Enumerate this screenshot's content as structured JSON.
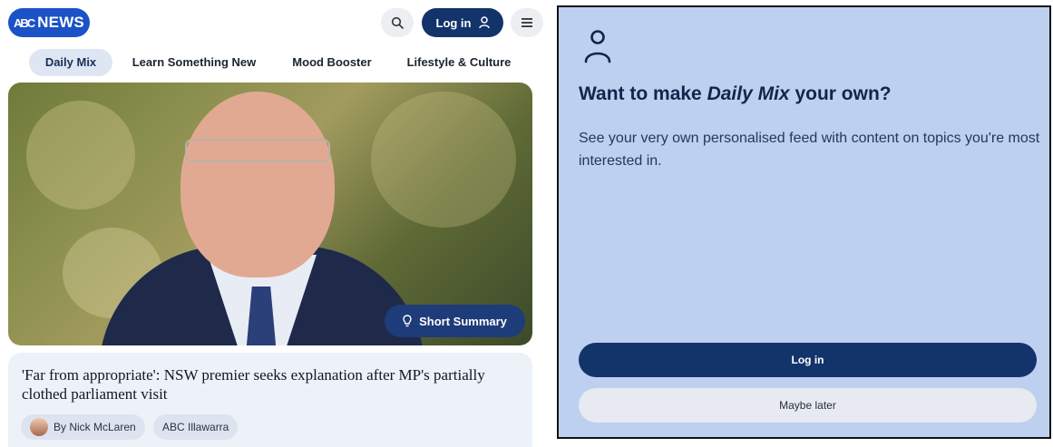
{
  "header": {
    "logo_mark": "ABC",
    "logo_text": "NEWS",
    "login_label": "Log in"
  },
  "tabs": [
    {
      "label": "Daily Mix",
      "active": true
    },
    {
      "label": "Learn Something New",
      "active": false
    },
    {
      "label": "Mood Booster",
      "active": false
    },
    {
      "label": "Lifestyle & Culture",
      "active": false
    }
  ],
  "hero": {
    "summary_button": "Short Summary"
  },
  "article": {
    "headline": "'Far from appropriate': NSW premier seeks explanation after MP's partially clothed parliament visit",
    "author": "By Nick McLaren",
    "source": "ABC Illawarra"
  },
  "dialog": {
    "title_prefix": "Want to make ",
    "title_emphasis": "Daily Mix",
    "title_suffix": " your own?",
    "body": "See your very own personalised feed with content on topics you're most interested in.",
    "login_button": "Log in",
    "later_button": "Maybe later"
  },
  "colors": {
    "brand": "#1a52c7",
    "primary_dark": "#13336b",
    "dialog_bg": "#bdd0f0"
  },
  "icons": [
    "search-icon",
    "user-icon",
    "menu-icon",
    "lightbulb-icon",
    "person-icon"
  ]
}
